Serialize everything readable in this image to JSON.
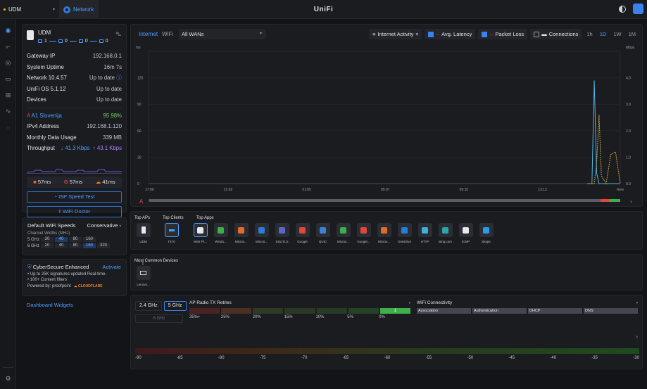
{
  "topbar": {
    "console": "UDM",
    "app": "Network",
    "brand": "UniFi"
  },
  "device": {
    "name": "UDM",
    "ports": [
      "1",
      "0",
      "0",
      "0"
    ],
    "rows": [
      {
        "k": "Gateway IP",
        "v": "192.168.0.1"
      },
      {
        "k": "System Uptime",
        "v": "16m 7s"
      },
      {
        "k": "Network 10.4.57",
        "v": "Up to date"
      },
      {
        "k": "UniFi OS 5.1.12",
        "v": "Up to date"
      },
      {
        "k": "Devices",
        "v": "Up to date"
      }
    ],
    "isp_name": "A1 Slovenija",
    "isp_uptime": "95.98%",
    "wan_rows": [
      {
        "k": "IPv4 Address",
        "v": "192.168.1.120"
      },
      {
        "k": "Monthly Data Usage",
        "v": "339 MB"
      }
    ],
    "throughput_label": "Throughput",
    "down": "41.3 Kbps",
    "up": "43.1 Kbps",
    "latency": [
      {
        "icon": "microsoft-icon",
        "v": "57ms"
      },
      {
        "icon": "google-icon",
        "v": "57ms"
      },
      {
        "icon": "cloudflare-icon",
        "v": "41ms"
      }
    ],
    "speed_test": "ISP Speed Test",
    "wifi_doctor": "WiFi Doctor"
  },
  "wifi": {
    "title": "Default WiFi Speeds",
    "mode": "Conservative",
    "widths_label": "Channel Widths (MHz)",
    "rows": [
      {
        "band": "5 GHz",
        "opts": [
          "20",
          "40",
          "80",
          "160"
        ],
        "sel": 1
      },
      {
        "band": "6 GHz",
        "opts": [
          "20",
          "40",
          "80",
          "160",
          "320"
        ],
        "sel": 3
      }
    ]
  },
  "cyber": {
    "title": "CyberSecure Enhanced",
    "activate": "Activate",
    "bullets": [
      "Up to 25K signatures updated Real-time.",
      "100+ Content filters"
    ],
    "powered": "Powered by: proofpoint",
    "partner": "CLOUDFLARE"
  },
  "dashboard_widgets": "Dashboard Widgets",
  "traffic": {
    "tab_internet": "Internet",
    "tab_wifi": "WiFi",
    "wan": "All WANs",
    "activity": "Internet Activity",
    "avg_latency": "Avg. Latency",
    "packet_loss": "Packet Loss",
    "connections": "Connections",
    "ranges": [
      "1h",
      "1D",
      "1W",
      "1M"
    ],
    "active_range": "1D"
  },
  "chart_data": {
    "type": "line",
    "left_unit": "ms",
    "right_unit": "Mbps",
    "y_left_ticks": [
      0,
      30,
      60,
      90,
      120
    ],
    "y_right_ticks": [
      "0.0",
      "1.0",
      "2.0",
      "3.0",
      "4.0"
    ],
    "x_ticks": [
      "17:00",
      "21:02",
      "01:05",
      "05:07",
      "09:10",
      "13:13",
      "Now"
    ],
    "ylim_left": [
      0,
      150
    ],
    "ylim_right": [
      0,
      5
    ],
    "series": [
      {
        "color": "#4db6e8",
        "x": [
          0.93,
          0.94,
          0.945,
          0.95,
          0.955,
          0.96,
          1.0
        ],
        "y": [
          0,
          0,
          3.9,
          0.4,
          0,
          0,
          0
        ]
      },
      {
        "color": "#c79f3a",
        "x": [
          0.93,
          0.945,
          0.95,
          0.955,
          0.96,
          0.97,
          0.98,
          0.99,
          1.0
        ],
        "y": [
          0,
          0,
          0.8,
          2.6,
          0.3,
          0,
          1.1,
          1.2,
          0
        ]
      }
    ]
  },
  "apps": {
    "top_aps": "Top APs",
    "top_clients": "Top Clients",
    "top_apps": "Top Apps",
    "aps": [
      {
        "icon": "udm-icon",
        "name": "UDM"
      }
    ],
    "clients": [
      {
        "icon": "client-icon",
        "name": "T470"
      }
    ],
    "list": [
      {
        "name": "Web Fil...",
        "color": "#e6e8ec",
        "icon": "web-filter-icon"
      },
      {
        "name": "Windo...",
        "color": "#3fae4a",
        "icon": "windows-icon"
      },
      {
        "name": "Micros...",
        "color": "#e26b2d",
        "icon": "microsoft-icon"
      },
      {
        "name": "Micros...",
        "color": "#2b7bd8",
        "icon": "bing-icon"
      },
      {
        "name": "SSL/TLS",
        "color": "#5b66c9",
        "icon": "ssl-icon"
      },
      {
        "name": "Google",
        "color": "#e0463a",
        "icon": "google-icon"
      },
      {
        "name": "QUIC",
        "color": "#3b82d8",
        "icon": "quic-icon"
      },
      {
        "name": "Micros...",
        "color": "#3fae4a",
        "icon": "microsoft-store-icon"
      },
      {
        "name": "Google...",
        "color": "#e0463a",
        "icon": "google-play-icon"
      },
      {
        "name": "Micros...",
        "color": "#e26b2d",
        "icon": "office-icon"
      },
      {
        "name": "OneDrive",
        "color": "#2b7bd8",
        "icon": "onedrive-icon"
      },
      {
        "name": "HTTP",
        "color": "#3faed8",
        "icon": "http-icon"
      },
      {
        "name": "Bing.com",
        "color": "#2ba6a8",
        "icon": "bing-com-icon"
      },
      {
        "name": "ICMP",
        "color": "#e6e8ec",
        "icon": "icmp-icon"
      },
      {
        "name": "Skype",
        "color": "#2b9be8",
        "icon": "skype-icon"
      }
    ]
  },
  "common": {
    "title": "Most Common Devices",
    "device_name": "Lenovo...",
    "device_count": "1"
  },
  "radio": {
    "band_24": "2.4 GHz",
    "band_5": "5 GHz",
    "band_6": "6 GHz",
    "retry_title": "AP Radio TX Retries",
    "retry_levels": [
      "35%+",
      "25%",
      "20%",
      "15%",
      "10%",
      "5%",
      "0%"
    ],
    "retry_colors": [
      "#4a2424",
      "#4a3022",
      "#2f3a26",
      "#2a3826",
      "#263a26",
      "#264226",
      "#3fae4a"
    ],
    "retry_active": "1",
    "conn_title": "WiFi Connectivity",
    "conn_steps": [
      "Association",
      "Authentication",
      "DHCP",
      "DNS"
    ],
    "signal_ticks": [
      "-90",
      "-85",
      "-80",
      "-75",
      "-70",
      "-65",
      "-60",
      "-55",
      "-50",
      "-45",
      "-40",
      "-35",
      "-30"
    ]
  }
}
